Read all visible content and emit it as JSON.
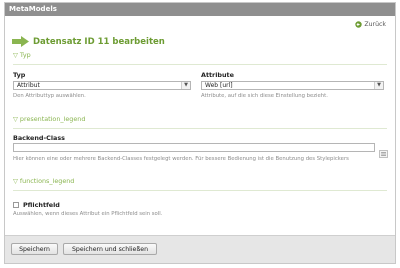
{
  "window": {
    "title": "MetaModels"
  },
  "header": {
    "back_label": "Zurück",
    "heading": "Datensatz ID 11 bearbeiten"
  },
  "sections": {
    "typ": {
      "legend": "Typ"
    },
    "presentation": {
      "legend": "presentation_legend"
    },
    "functions": {
      "legend": "functions_legend"
    }
  },
  "fields": {
    "typ": {
      "label": "Typ",
      "value": "Attribut",
      "help": "Den Attributtyp auswählen."
    },
    "attribute": {
      "label": "Attribute",
      "value": "Web [url]",
      "help": "Attribute, auf die sich diese Einstellung bezieht."
    },
    "backend_class": {
      "label": "Backend-Class",
      "value": "",
      "help": "Hier können eine oder mehrere Backend-Classes festgelegt werden. Für bessere Bedienung ist die Benutzung des Stylepickers"
    },
    "mandatory": {
      "label": "Pflichtfeld",
      "checked": false,
      "help": "Auswählen, wenn dieses Attribut ein Pflichtfeld sein soll."
    }
  },
  "actions": {
    "save_label": "Speichern",
    "save_close_label": "Speichern und schließen"
  },
  "colors": {
    "accent_green": "#6d9c33",
    "legend_green": "#8ab550",
    "titlebar_gray": "#8f8f8f"
  }
}
